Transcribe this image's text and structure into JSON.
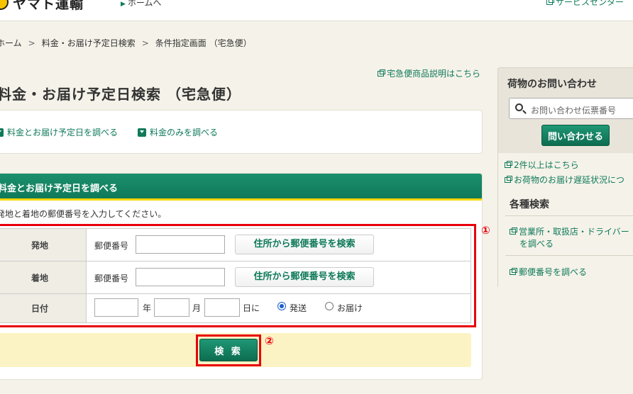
{
  "header": {
    "logo_text": "ヤマト運輸",
    "home_link": "ホームへ",
    "service_link": "サービスセンター"
  },
  "breadcrumb": [
    "ホーム",
    "料金・お届け予定日検索",
    "条件指定画面 （宅急便）"
  ],
  "product_link": "宅急便商品説明はこちら",
  "page_title": "料金・お届け予定日検索 （宅急便）",
  "modes": {
    "fee_and_date": "料金とお届け予定日を調べる",
    "fee_only": "料金のみを調べる"
  },
  "form": {
    "header": "料金とお届け予定日を調べる",
    "instruction": "発地と着地の郵便番号を入力してください。",
    "rows": {
      "origin_label": "発地",
      "destination_label": "着地",
      "date_label": "日付"
    },
    "postal_label": "郵便番号",
    "address_search_button": "住所から郵便番号を検索",
    "date": {
      "year_unit": "年",
      "month_unit": "月",
      "day_unit": "日に",
      "option_send": "発送",
      "option_deliver": "お届け",
      "selected": "発送"
    },
    "search_button": "検 索",
    "annotation_1": "①",
    "annotation_2": "②"
  },
  "sidebar": {
    "title": "荷物のお問い合わせ",
    "search_placeholder": "お問い合わせ伝票番号",
    "inquiry_button": "問い合わせる",
    "links": {
      "multi": "2件以上はこちら",
      "delay": "お荷物のお届け遅延状況につ"
    },
    "heading": "各種検索",
    "office_link_line1": "営業所・取扱店・ドライバー",
    "office_link_line2": "を調べる",
    "postal_link": "郵便番号を調べる"
  },
  "colors": {
    "brand_green": "#0f7a5a",
    "accent_yellow": "#f3d400",
    "annotation_red": "#e8000b"
  }
}
